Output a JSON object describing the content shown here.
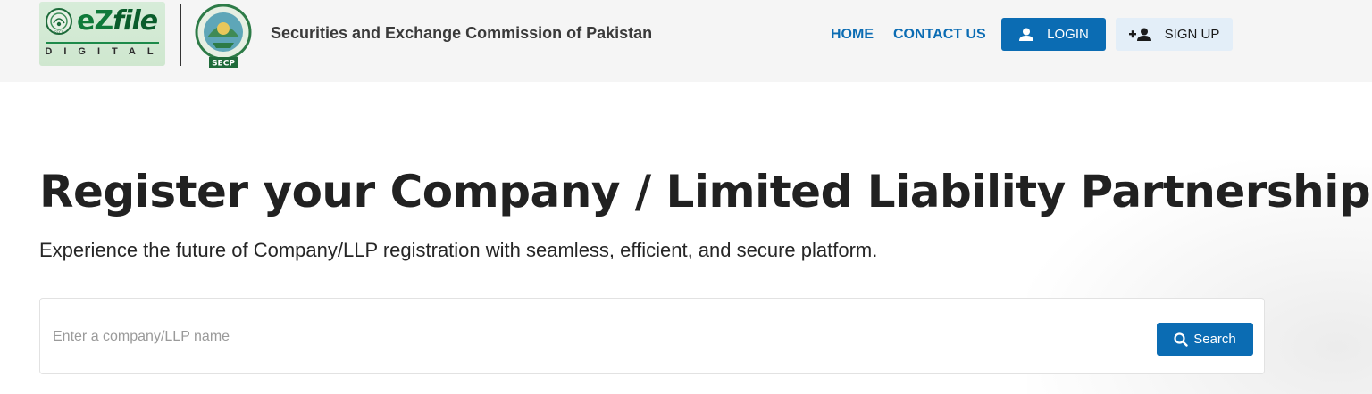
{
  "header": {
    "logo": {
      "brand_prefix": "eZ",
      "brand_suffix": "file",
      "sub": "DIGITAL",
      "seal_text": "SECP"
    },
    "secp_logo_label": "SECP",
    "org_title": "Securities and Exchange Commission of Pakistan",
    "nav": {
      "home": "HOME",
      "contact": "CONTACT US",
      "login": "LOGIN",
      "signup": "SIGN UP"
    }
  },
  "hero": {
    "title": "Register your Company / Limited Liability Partnership",
    "subtitle": "Experience the future of Company/LLP registration with seamless, efficient, and secure platform."
  },
  "search": {
    "placeholder": "Enter a company/LLP name",
    "value": "",
    "button_label": "Search"
  },
  "colors": {
    "accent": "#0b6cb3",
    "brand_green": "#0f7a3a",
    "header_bg": "#f5f5f5",
    "signup_bg": "#e3eef8"
  },
  "icons": {
    "login": "user-icon",
    "signup": "add-user-icon",
    "search": "search-icon"
  }
}
